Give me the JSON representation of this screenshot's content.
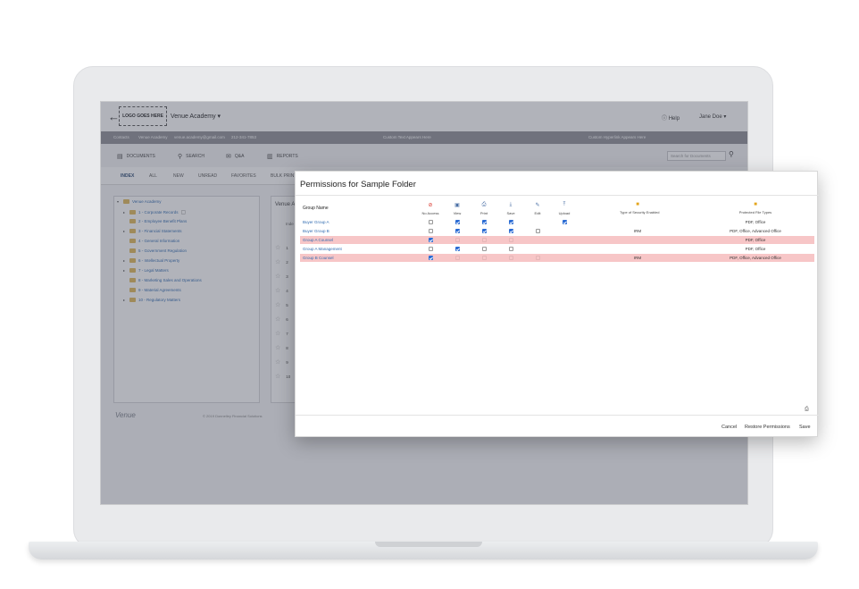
{
  "header": {
    "back_icon": "arrow-left-icon",
    "logo_text": "LOGO GOES HERE",
    "app_name": "Venue Academy ▾",
    "help": "Help",
    "user": "Jane Doe ▾"
  },
  "info_bar": {
    "contacts": "Contacts",
    "org": "Venue Academy",
    "email": "venue.academy@gmail.com",
    "phone": "212-341-7853",
    "custom_text": "Custom Text Appears Here",
    "custom_link": "Custom Hyperlink Appears Here"
  },
  "nav": {
    "items": [
      {
        "label": "DOCUMENTS",
        "icon": "documents-icon"
      },
      {
        "label": "SEARCH",
        "icon": "search-icon"
      },
      {
        "label": "Q&A",
        "icon": "chat-icon"
      },
      {
        "label": "REPORTS",
        "icon": "chart-icon"
      }
    ],
    "search_placeholder": "Search for Documents"
  },
  "tabs": [
    "INDEX",
    "ALL",
    "NEW",
    "UNREAD",
    "FAVORITES",
    "BULK PRINT"
  ],
  "tree": [
    {
      "label": "Venue Academy",
      "caret": "▾"
    },
    {
      "label": "1 - Corporate Records",
      "caret": "▸"
    },
    {
      "label": "2 - Employee Benefit Plans",
      "caret": ""
    },
    {
      "label": "3 - Financial Statements",
      "caret": "▸"
    },
    {
      "label": "4 - General Information",
      "caret": ""
    },
    {
      "label": "5 - Government Regulation",
      "caret": ""
    },
    {
      "label": "6 - Intellectual Property",
      "caret": "▸"
    },
    {
      "label": "7 - Legal Matters",
      "caret": "▸"
    },
    {
      "label": "8 - Marketing Sales and Operations",
      "caret": ""
    },
    {
      "label": "9 - Material Agreements",
      "caret": ""
    },
    {
      "label": "10 - Regulatory Matters",
      "caret": "▸"
    }
  ],
  "doc_panel": {
    "title": "Venue A",
    "sub": "Inde",
    "rows": [
      "1",
      "2",
      "3",
      "4",
      "5",
      "6",
      "7",
      "8",
      "9",
      "10"
    ]
  },
  "footer": {
    "logo": "Venue",
    "copyright": "© 2019 Donnelley Financial Solutions"
  },
  "modal": {
    "title": "Permissions for  Sample Folder",
    "group_name_header": "Group Name",
    "columns": [
      {
        "label": "No Access",
        "icon": "no-access-icon"
      },
      {
        "label": "View",
        "icon": "view-icon"
      },
      {
        "label": "Print",
        "icon": "print-icon"
      },
      {
        "label": "Save",
        "icon": "save-icon"
      },
      {
        "label": "Edit",
        "icon": "edit-icon"
      },
      {
        "label": "Upload",
        "icon": "upload-icon"
      },
      {
        "label": "Type of Security Enabled",
        "icon": "lock-icon"
      },
      {
        "label": "Protected File Types",
        "icon": "lock-icon"
      }
    ],
    "rows": [
      {
        "name": "Buyer Group A",
        "no_access": false,
        "view": true,
        "print": true,
        "save": true,
        "edit": null,
        "upload": true,
        "security": "",
        "file_types": "PDF, Office",
        "highlight": false
      },
      {
        "name": "Buyer Group B",
        "no_access": false,
        "view": true,
        "print": true,
        "save": true,
        "edit": false,
        "upload": null,
        "security": "IRM",
        "file_types": "PDF, Office, Advanced Office",
        "highlight": false
      },
      {
        "name": "Group A Counsel",
        "no_access": true,
        "view": false,
        "print": false,
        "save": false,
        "edit": null,
        "upload": null,
        "security": "",
        "file_types": "PDF, Office",
        "highlight": true
      },
      {
        "name": "Group A Management",
        "no_access": false,
        "view": true,
        "print": false,
        "save": false,
        "edit": null,
        "upload": null,
        "security": "",
        "file_types": "PDF, Office",
        "highlight": false
      },
      {
        "name": "Group B Counsel",
        "no_access": true,
        "view": false,
        "print": false,
        "save": false,
        "edit": false,
        "upload": null,
        "security": "IRM",
        "file_types": "PDF, Office, Advanced Office",
        "highlight": true
      }
    ],
    "buttons": {
      "cancel": "Cancel",
      "restore": "Restore Permissions",
      "save": "Save"
    }
  }
}
